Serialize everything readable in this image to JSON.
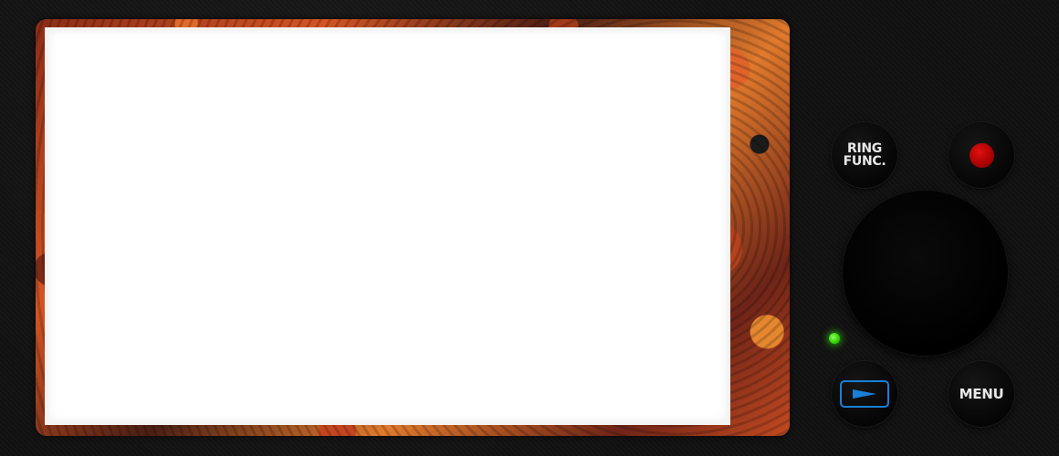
{
  "buttons": {
    "ring_func_label": "RING\nFUNC.",
    "menu_label": "MENU",
    "record_icon": "record-dot-icon",
    "play_icon": "playback-triangle-icon"
  },
  "colors": {
    "record": "#cc0000",
    "play_accent": "#1a7fd8",
    "led": "#39e610",
    "screen": "#ffffff"
  },
  "status": {
    "led_state": "on"
  }
}
